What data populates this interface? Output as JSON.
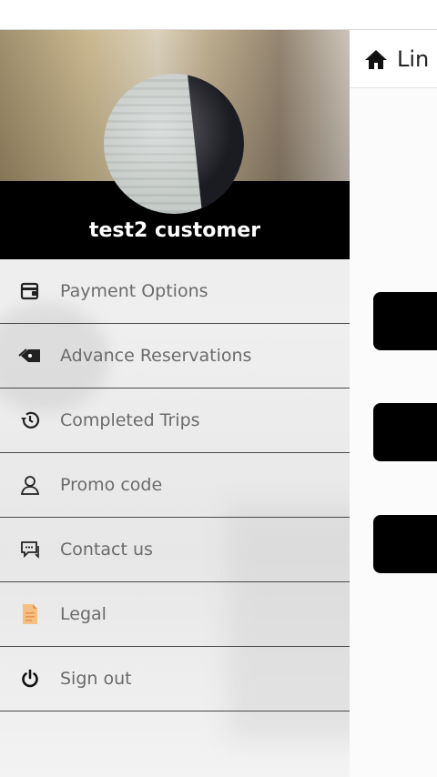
{
  "app": {
    "header_title": "Lin",
    "buttons": [
      "",
      "",
      ""
    ]
  },
  "profile": {
    "name": "test2 customer"
  },
  "menu": {
    "items": [
      {
        "label": "Payment Options",
        "icon": "wallet-icon"
      },
      {
        "label": "Advance Reservations",
        "icon": "tag-icon"
      },
      {
        "label": "Completed Trips",
        "icon": "history-icon"
      },
      {
        "label": "Promo code",
        "icon": "user-icon"
      },
      {
        "label": "Contact us",
        "icon": "chat-icon"
      },
      {
        "label": "Legal",
        "icon": "document-icon"
      },
      {
        "label": "Sign out",
        "icon": "power-icon"
      }
    ]
  },
  "colors": {
    "menu_text": "#6b6b6b",
    "legal_icon": "#f2a65a",
    "header_black": "#000000"
  }
}
